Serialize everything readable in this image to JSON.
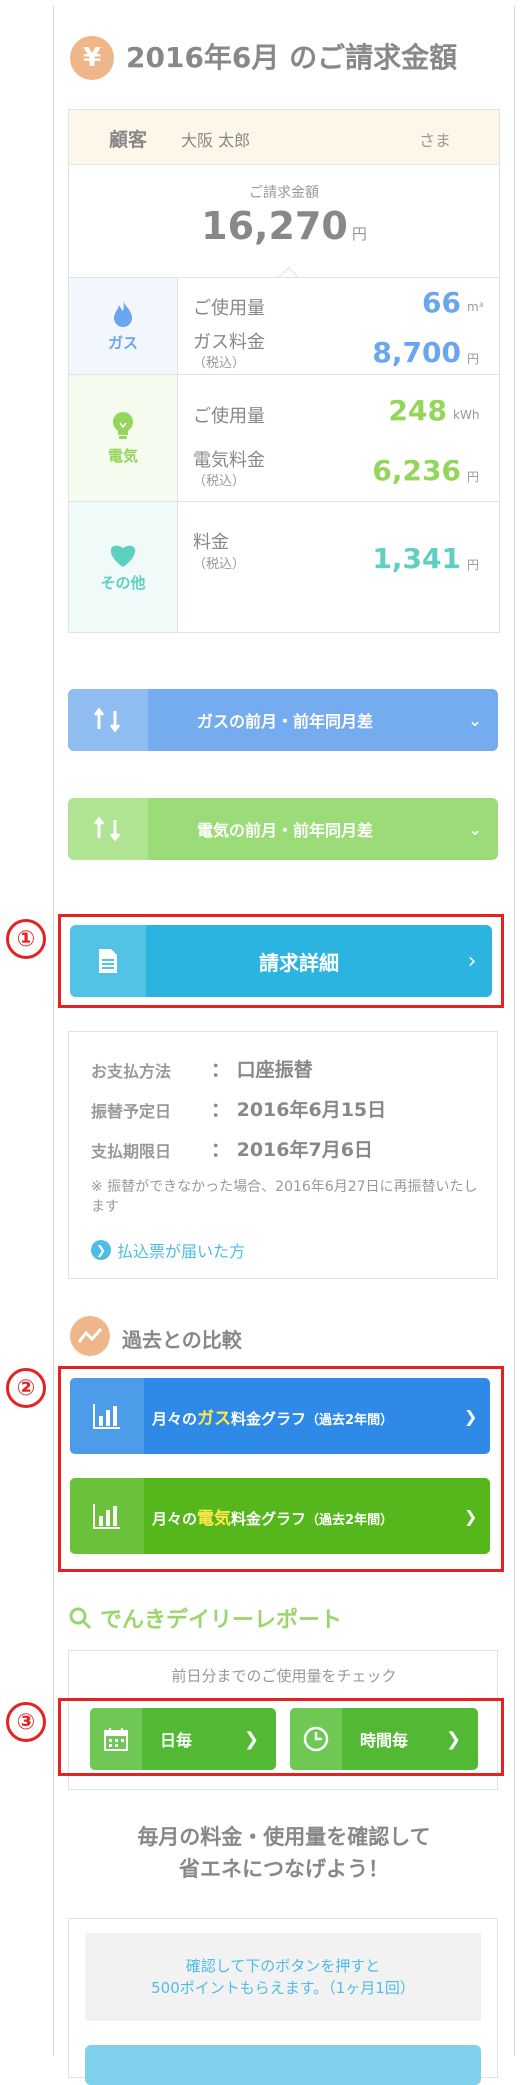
{
  "header": {
    "yen_symbol": "¥",
    "title": "2016年6月 のご請求金額"
  },
  "customer": {
    "label": "顧客",
    "name": "大阪 太郎",
    "honorific": "さま"
  },
  "bill": {
    "label": "ご請求金額",
    "amount": "16,270",
    "unit": "円"
  },
  "gas": {
    "category": "ガス",
    "usage_label": "ご使用量",
    "usage_value": "66",
    "usage_unit": "m³",
    "fee_label": "ガス料金",
    "tax_note": "（税込）",
    "fee_value": "8,700",
    "fee_unit": "円",
    "color": "#6aa6ee"
  },
  "electric": {
    "category": "電気",
    "usage_label": "ご使用量",
    "usage_value": "248",
    "usage_unit": "kWh",
    "fee_label": "電気料金",
    "tax_note": "（税込）",
    "fee_value": "6,236",
    "fee_unit": "円",
    "color": "#96d55c"
  },
  "other": {
    "category": "その他",
    "fee_label": "料金",
    "tax_note": "（税込）",
    "fee_value": "1,341",
    "fee_unit": "円",
    "color": "#5fcfc2"
  },
  "accordions": {
    "gas_label": "ガスの前月・前年同月差",
    "electric_label": "電気の前月・前年同月差"
  },
  "markers": {
    "one": "①",
    "two": "②",
    "three": "③"
  },
  "detail_button": {
    "label": "請求詳細"
  },
  "payment": {
    "method_label": "お支払方法",
    "method_value": "： 口座振替",
    "transfer_label": "振替予定日",
    "transfer_value": "： 2016年6月15日",
    "deadline_label": "支払期限日",
    "deadline_value": "： 2016年7月6日",
    "note": "※ 振替ができなかった場合、2016年6月27日に再振替いたします",
    "slip_link": "払込票が届いた方"
  },
  "comparison": {
    "title": "過去との比較",
    "gas_graph": {
      "prefix": "月々の",
      "highlight": "ガス",
      "suffix": "料金グラフ",
      "period": "（過去2年間）"
    },
    "electric_graph": {
      "prefix": "月々の",
      "highlight": "電気",
      "suffix": "料金グラフ",
      "period": "（過去2年間）"
    }
  },
  "daily": {
    "title": "でんきデイリーレポート",
    "subtitle": "前日分までのご使用量をチェック",
    "daily_button": "日毎",
    "hourly_button": "時間毎"
  },
  "cta": {
    "line1": "毎月の料金・使用量を確認して",
    "line2": "省エネにつなげよう！"
  },
  "points": {
    "line1": "確認して下のボタンを押すと",
    "line2": "500ポイントもらえます。（1ヶ月1回）"
  }
}
